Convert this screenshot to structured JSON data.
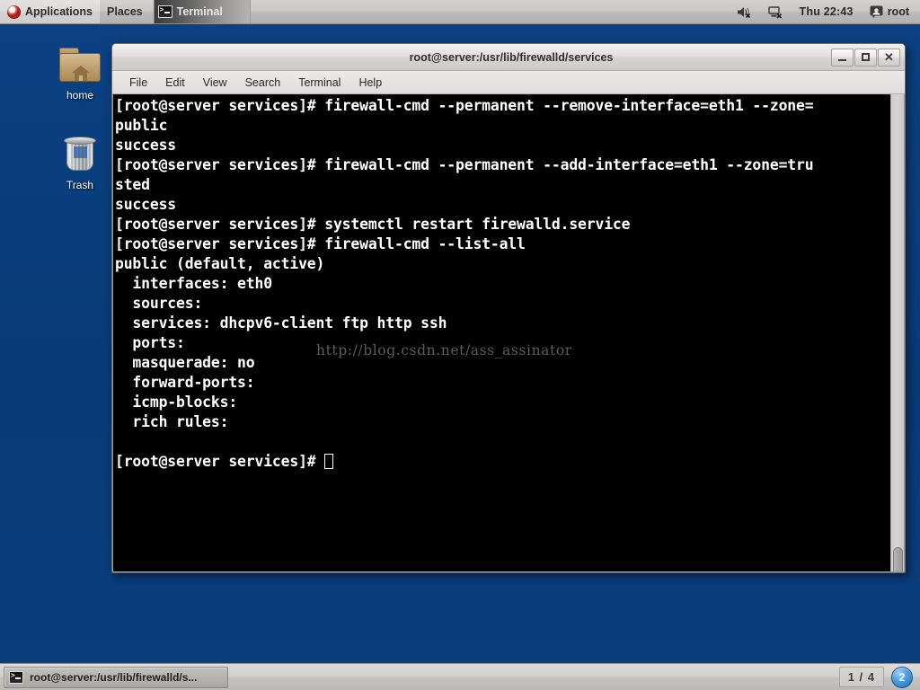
{
  "top_panel": {
    "menus": [
      {
        "label": "Applications",
        "icon": "fedora-logo-icon"
      },
      {
        "label": "Places",
        "icon": null
      }
    ],
    "window_buttons": [
      {
        "label": "Terminal",
        "icon": "terminal-icon",
        "active": true
      }
    ],
    "tray": {
      "volume_icon": "volume-muted-icon",
      "network_icon": "network-disconnected-icon",
      "clock": "Thu 22:43",
      "user_icon": "user-icon",
      "user": "root"
    }
  },
  "desktop": {
    "background_color": "#0a3f80",
    "icons": [
      {
        "label": "home",
        "icon": "home-folder-icon"
      },
      {
        "label": "Trash",
        "icon": "trash-icon"
      }
    ]
  },
  "window": {
    "title": "root@server:/usr/lib/firewalld/services",
    "controls": {
      "minimize": "minimize-icon",
      "maximize": "maximize-icon",
      "close": "close-icon"
    },
    "menubar": [
      "File",
      "Edit",
      "View",
      "Search",
      "Terminal",
      "Help"
    ],
    "terminal": {
      "background_color": "#000000",
      "foreground_color": "#ffffff",
      "cursor": "block-outline",
      "content": "[root@server services]# firewall-cmd --permanent --remove-interface=eth1 --zone=\npublic\nsuccess\n[root@server services]# firewall-cmd --permanent --add-interface=eth1 --zone=tru\nsted\nsuccess\n[root@server services]# systemctl restart firewalld.service\n[root@server services]# firewall-cmd --list-all\npublic (default, active)\n  interfaces: eth0\n  sources:\n  services: dhcpv6-client ftp http ssh\n  ports:\n  masquerade: no\n  forward-ports:\n  icmp-blocks:\n  rich rules:\n\n[root@server services]# ",
      "watermark": "http://blog.csdn.net/ass_assinator"
    }
  },
  "bottom_panel": {
    "tasks": [
      {
        "label": "root@server:/usr/lib/firewalld/s...",
        "icon": "terminal-icon"
      }
    ],
    "workspace": "1 / 4",
    "notification_count": "2"
  }
}
